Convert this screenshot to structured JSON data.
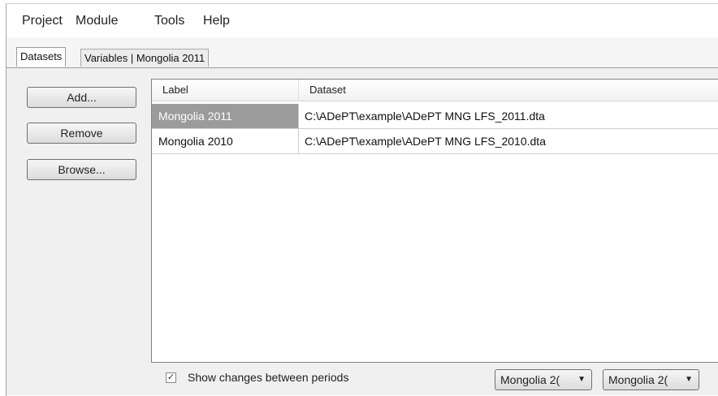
{
  "menubar": {
    "items": [
      {
        "label": "Project"
      },
      {
        "label": "Module"
      },
      {
        "label": "Tools"
      },
      {
        "label": "Help"
      }
    ]
  },
  "tabs": [
    {
      "label": "Datasets",
      "active": true
    },
    {
      "label": "Variables | Mongolia 2011",
      "active": false
    }
  ],
  "buttons": {
    "add": "Add...",
    "remove": "Remove",
    "browse": "Browse..."
  },
  "table": {
    "columns": [
      "Label",
      "Dataset"
    ],
    "rows": [
      {
        "label": "Mongolia 2011",
        "dataset": "C:\\ADePT\\example\\ADePT MNG LFS_2011.dta",
        "selected": true
      },
      {
        "label": "Mongolia 2010",
        "dataset": "C:\\ADePT\\example\\ADePT MNG LFS_2010.dta",
        "selected": false
      }
    ]
  },
  "footer": {
    "show_changes_label": "Show changes between periods",
    "show_changes_checked": true,
    "period_from": "Mongolia 2(",
    "period_to": "Mongolia 2("
  },
  "icons": {
    "checkmark": "check-icon",
    "dropdown": "triangle-down-icon"
  }
}
